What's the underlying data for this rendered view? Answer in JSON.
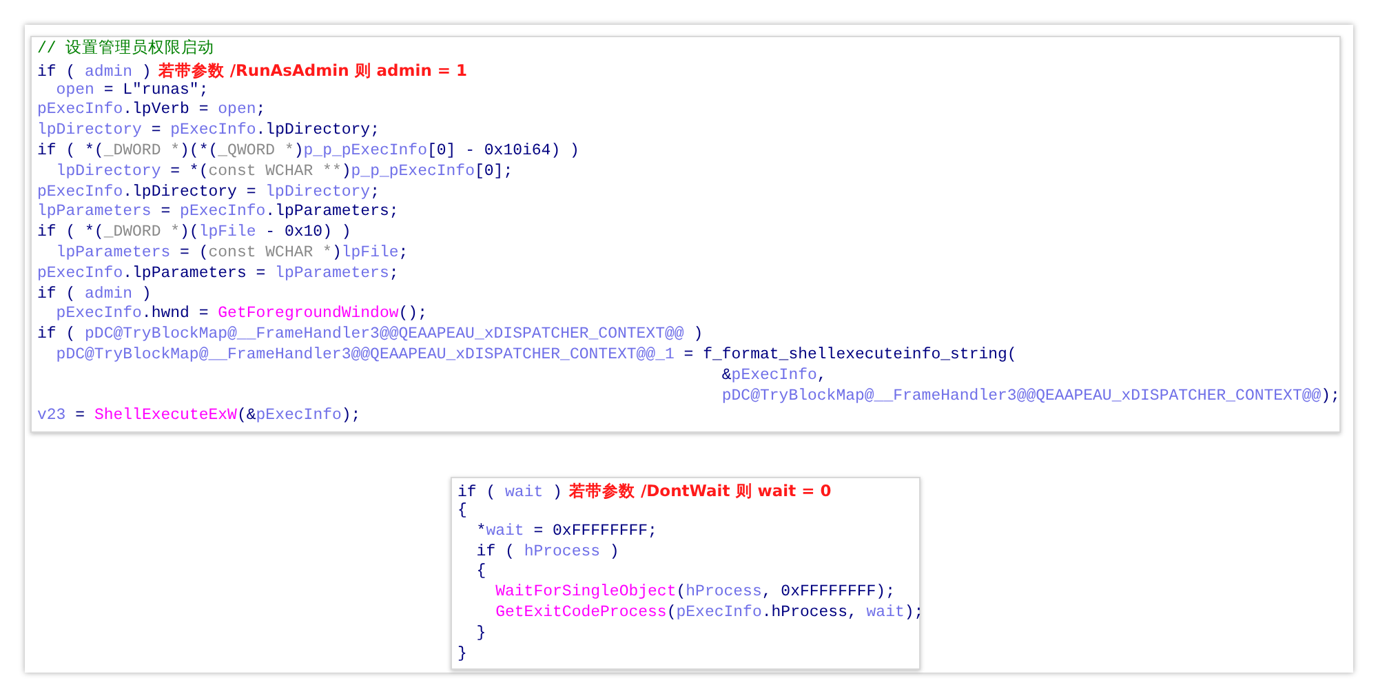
{
  "panels": [
    {
      "lines": [
        {
          "tokens": [
            {
              "kind": "comment",
              "text": "// 设置管理员权限启动"
            }
          ]
        },
        {
          "tokens": [
            {
              "kind": "keyword",
              "text": "if ( "
            },
            {
              "kind": "variable",
              "text": "admin"
            },
            {
              "kind": "keyword",
              "text": " )"
            }
          ],
          "note": "若带参数 /RunAsAdmin 则 admin = 1"
        },
        {
          "tokens": [
            {
              "kind": "variable",
              "text": "  open"
            },
            {
              "kind": "keyword",
              "text": " = L\"runas\";"
            }
          ]
        },
        {
          "tokens": [
            {
              "kind": "variable",
              "text": "pExecInfo"
            },
            {
              "kind": "keyword",
              "text": ".lpVerb = "
            },
            {
              "kind": "variable",
              "text": "open"
            },
            {
              "kind": "keyword",
              "text": ";"
            }
          ]
        },
        {
          "tokens": [
            {
              "kind": "variable",
              "text": "lpDirectory"
            },
            {
              "kind": "keyword",
              "text": " = "
            },
            {
              "kind": "variable",
              "text": "pExecInfo"
            },
            {
              "kind": "keyword",
              "text": ".lpDirectory;"
            }
          ]
        },
        {
          "tokens": [
            {
              "kind": "keyword",
              "text": "if ( *("
            },
            {
              "kind": "type",
              "text": "_DWORD *"
            },
            {
              "kind": "keyword",
              "text": ")(*("
            },
            {
              "kind": "type",
              "text": "_QWORD *"
            },
            {
              "kind": "keyword",
              "text": ")"
            },
            {
              "kind": "variable",
              "text": "p_p_pExecInfo"
            },
            {
              "kind": "keyword",
              "text": "[0] - 0x10i64) )"
            }
          ]
        },
        {
          "tokens": [
            {
              "kind": "variable",
              "text": "  lpDirectory"
            },
            {
              "kind": "keyword",
              "text": " = *("
            },
            {
              "kind": "type",
              "text": "const WCHAR **"
            },
            {
              "kind": "keyword",
              "text": ")"
            },
            {
              "kind": "variable",
              "text": "p_p_pExecInfo"
            },
            {
              "kind": "keyword",
              "text": "[0];"
            }
          ]
        },
        {
          "tokens": [
            {
              "kind": "variable",
              "text": "pExecInfo"
            },
            {
              "kind": "keyword",
              "text": ".lpDirectory = "
            },
            {
              "kind": "variable",
              "text": "lpDirectory"
            },
            {
              "kind": "keyword",
              "text": ";"
            }
          ]
        },
        {
          "tokens": [
            {
              "kind": "variable",
              "text": "lpParameters"
            },
            {
              "kind": "keyword",
              "text": " = "
            },
            {
              "kind": "variable",
              "text": "pExecInfo"
            },
            {
              "kind": "keyword",
              "text": ".lpParameters;"
            }
          ]
        },
        {
          "tokens": [
            {
              "kind": "keyword",
              "text": "if ( *("
            },
            {
              "kind": "type",
              "text": "_DWORD *"
            },
            {
              "kind": "keyword",
              "text": ")("
            },
            {
              "kind": "variable",
              "text": "lpFile"
            },
            {
              "kind": "keyword",
              "text": " - 0x10) )"
            }
          ]
        },
        {
          "tokens": [
            {
              "kind": "variable",
              "text": "  lpParameters"
            },
            {
              "kind": "keyword",
              "text": " = ("
            },
            {
              "kind": "type",
              "text": "const WCHAR *"
            },
            {
              "kind": "keyword",
              "text": ")"
            },
            {
              "kind": "variable",
              "text": "lpFile"
            },
            {
              "kind": "keyword",
              "text": ";"
            }
          ]
        },
        {
          "tokens": [
            {
              "kind": "variable",
              "text": "pExecInfo"
            },
            {
              "kind": "keyword",
              "text": ".lpParameters = "
            },
            {
              "kind": "variable",
              "text": "lpParameters"
            },
            {
              "kind": "keyword",
              "text": ";"
            }
          ]
        },
        {
          "tokens": [
            {
              "kind": "keyword",
              "text": "if ( "
            },
            {
              "kind": "variable",
              "text": "admin"
            },
            {
              "kind": "keyword",
              "text": " )"
            }
          ]
        },
        {
          "tokens": [
            {
              "kind": "variable",
              "text": "  pExecInfo"
            },
            {
              "kind": "keyword",
              "text": ".hwnd = "
            },
            {
              "kind": "function",
              "text": "GetForegroundWindow"
            },
            {
              "kind": "keyword",
              "text": "();"
            }
          ]
        },
        {
          "tokens": [
            {
              "kind": "keyword",
              "text": "if ( "
            },
            {
              "kind": "variable",
              "text": "pDC@TryBlockMap@__FrameHandler3@@QEAAPEAU_xDISPATCHER_CONTEXT@@"
            },
            {
              "kind": "keyword",
              "text": " )"
            }
          ]
        },
        {
          "tokens": [
            {
              "kind": "variable",
              "text": "  pDC@TryBlockMap@__FrameHandler3@@QEAAPEAU_xDISPATCHER_CONTEXT@@_1"
            },
            {
              "kind": "keyword",
              "text": " = f_format_shellexecuteinfo_string("
            }
          ]
        },
        {
          "tokens": [
            {
              "kind": "keyword",
              "text": "                                                                        &"
            },
            {
              "kind": "variable",
              "text": "pExecInfo"
            },
            {
              "kind": "keyword",
              "text": ","
            }
          ]
        },
        {
          "tokens": [
            {
              "kind": "variable",
              "text": "                                                                        pDC@TryBlockMap@__FrameHandler3@@QEAAPEAU_xDISPATCHER_CONTEXT@@"
            },
            {
              "kind": "keyword",
              "text": ");"
            }
          ]
        },
        {
          "tokens": [
            {
              "kind": "variable",
              "text": "v23"
            },
            {
              "kind": "keyword",
              "text": " = "
            },
            {
              "kind": "function",
              "text": "ShellExecuteExW"
            },
            {
              "kind": "keyword",
              "text": "(&"
            },
            {
              "kind": "variable",
              "text": "pExecInfo"
            },
            {
              "kind": "keyword",
              "text": ");"
            }
          ]
        }
      ]
    },
    {
      "lines": [
        {
          "tokens": [
            {
              "kind": "keyword",
              "text": "if ( "
            },
            {
              "kind": "variable",
              "text": "wait"
            },
            {
              "kind": "keyword",
              "text": " )"
            }
          ],
          "note": "若带参数 /DontWait 则 wait = 0"
        },
        {
          "tokens": [
            {
              "kind": "keyword",
              "text": "{"
            }
          ]
        },
        {
          "tokens": [
            {
              "kind": "keyword",
              "text": "  *"
            },
            {
              "kind": "variable",
              "text": "wait"
            },
            {
              "kind": "keyword",
              "text": " = 0xFFFFFFFF;"
            }
          ]
        },
        {
          "tokens": [
            {
              "kind": "keyword",
              "text": "  if ( "
            },
            {
              "kind": "variable",
              "text": "hProcess"
            },
            {
              "kind": "keyword",
              "text": " )"
            }
          ]
        },
        {
          "tokens": [
            {
              "kind": "keyword",
              "text": "  {"
            }
          ]
        },
        {
          "tokens": [
            {
              "kind": "function",
              "text": "    WaitForSingleObject"
            },
            {
              "kind": "keyword",
              "text": "("
            },
            {
              "kind": "variable",
              "text": "hProcess"
            },
            {
              "kind": "keyword",
              "text": ", 0xFFFFFFFF);"
            }
          ]
        },
        {
          "tokens": [
            {
              "kind": "function",
              "text": "    GetExitCodeProcess"
            },
            {
              "kind": "keyword",
              "text": "("
            },
            {
              "kind": "variable",
              "text": "pExecInfo"
            },
            {
              "kind": "keyword",
              "text": ".hProcess, "
            },
            {
              "kind": "variable",
              "text": "wait"
            },
            {
              "kind": "keyword",
              "text": ");"
            }
          ]
        },
        {
          "tokens": [
            {
              "kind": "keyword",
              "text": "  }"
            }
          ]
        },
        {
          "tokens": [
            {
              "kind": "keyword",
              "text": "}"
            }
          ]
        }
      ]
    }
  ]
}
